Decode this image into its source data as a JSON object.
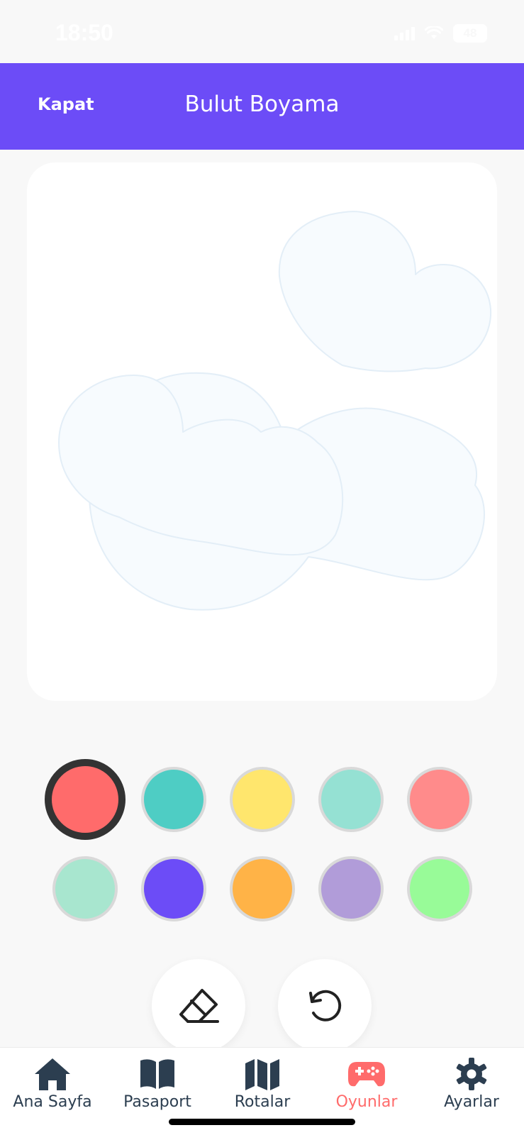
{
  "status_bar": {
    "time": "18:50",
    "battery": "48"
  },
  "header": {
    "close_label": "Kapat",
    "title": "Bulut Boyama"
  },
  "palette": {
    "selected_index": 0,
    "colors": [
      "#ff6b6b",
      "#4ecdc4",
      "#ffe66d",
      "#95e1d3",
      "#ff8b8b",
      "#a8e6cf",
      "#6c4cf7",
      "#ffb347",
      "#b19cd9",
      "#98fb98"
    ]
  },
  "tools": [
    {
      "name": "eraser",
      "icon": "eraser-icon"
    },
    {
      "name": "undo",
      "icon": "undo-icon"
    }
  ],
  "tabbar": {
    "active_index": 3,
    "active_color": "#ff6b6b",
    "inactive_color": "#2c3e50",
    "tabs": [
      {
        "label": "Ana Sayfa",
        "icon": "home-icon"
      },
      {
        "label": "Pasaport",
        "icon": "book-icon"
      },
      {
        "label": "Rotalar",
        "icon": "map-icon"
      },
      {
        "label": "Oyunlar",
        "icon": "gamepad-icon"
      },
      {
        "label": "Ayarlar",
        "icon": "gear-icon"
      }
    ]
  }
}
